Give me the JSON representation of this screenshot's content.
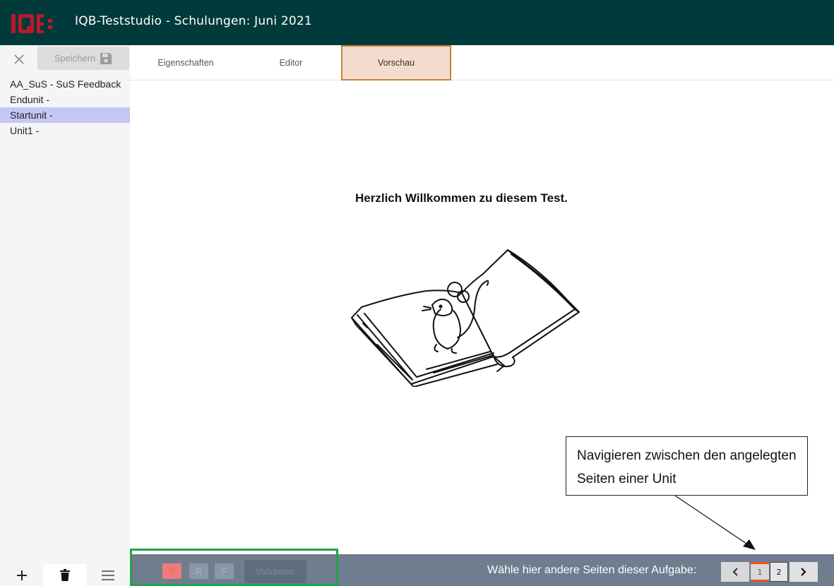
{
  "header": {
    "logo_text": "IQB",
    "title": "IQB-Teststudio - Schulungen: Juni 2021"
  },
  "sidebar": {
    "save_label": "Speichern",
    "units": [
      {
        "label": "AA_SuS - SuS Feedback",
        "selected": false
      },
      {
        "label": "Endunit -",
        "selected": false
      },
      {
        "label": "Startunit -",
        "selected": true
      },
      {
        "label": "Unit1 -",
        "selected": false
      }
    ]
  },
  "tabs": [
    {
      "label": "Eigenschaften",
      "active": false
    },
    {
      "label": "Editor",
      "active": false
    },
    {
      "label": "Vorschau",
      "active": true
    }
  ],
  "preview": {
    "welcome_text": "Herzlich Willkommen zu diesem Test."
  },
  "callout": {
    "text": "Navigieren zwischen den angelegten Seiten einer Unit"
  },
  "bottom_bar": {
    "presentation_label": "P",
    "response_label": "R",
    "focus_label": "F",
    "validate_label": "Validieren",
    "page_nav_label": "Wähle hier andere Seiten dieser Aufgabe:",
    "pages": [
      "1",
      "2"
    ],
    "current_page": "1"
  },
  "colors": {
    "header_bg": "#003a3a",
    "accent_tab": "#f3dccd",
    "selected_unit": "#c5c8f5",
    "bottom_bar_bg": "#6f7d8e",
    "highlight_box": "#1da34a",
    "current_page_marker": "#f04e23"
  }
}
